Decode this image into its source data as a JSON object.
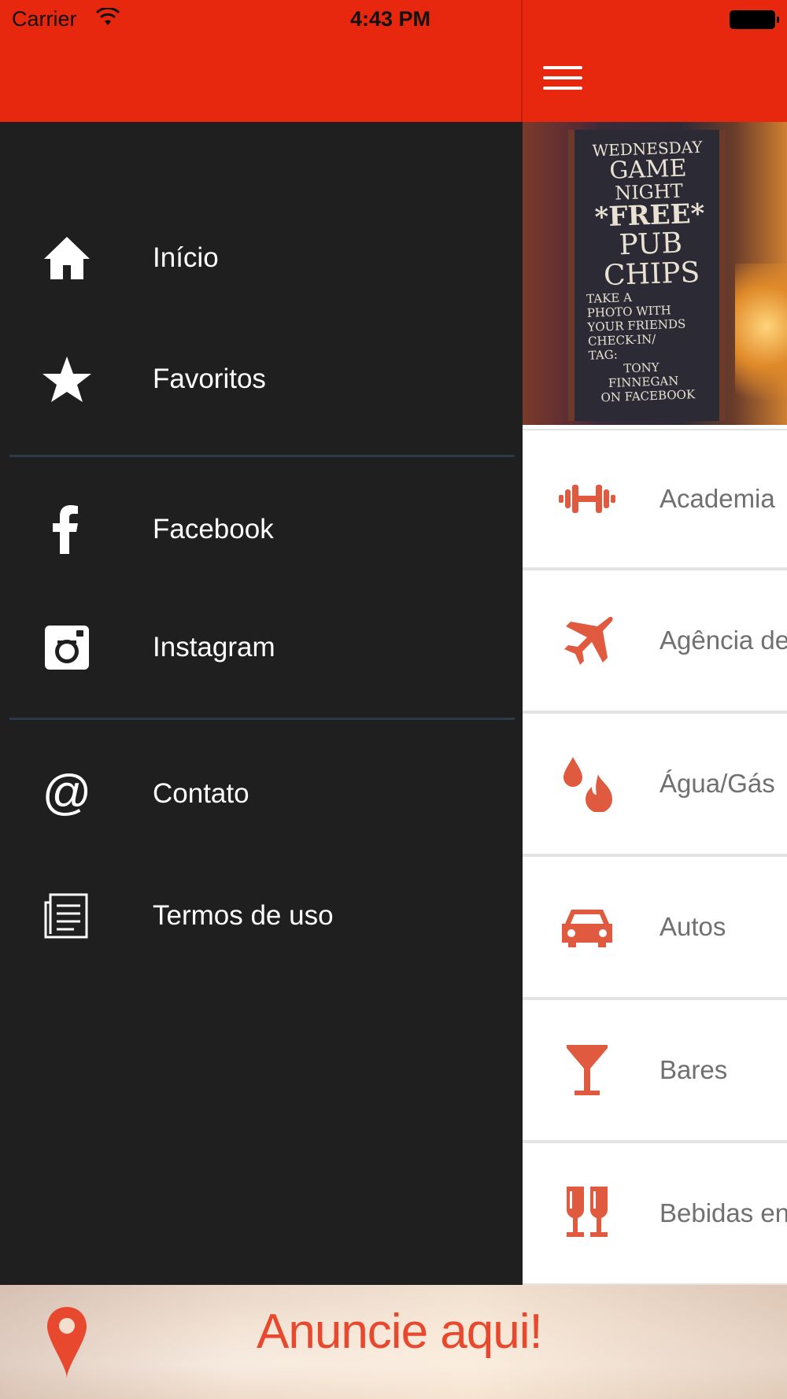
{
  "status_bar": {
    "carrier": "Carrier",
    "time": "4:43 PM"
  },
  "drawer": {
    "items": [
      {
        "label": "Início",
        "icon": "home-icon"
      },
      {
        "label": "Favoritos",
        "icon": "star-icon"
      },
      {
        "label": "Facebook",
        "icon": "facebook-icon"
      },
      {
        "label": "Instagram",
        "icon": "instagram-icon"
      },
      {
        "label": "Contato",
        "icon": "at-sign-icon"
      },
      {
        "label": "Termos de uso",
        "icon": "document-icon"
      }
    ]
  },
  "main": {
    "menu_icon": "hamburger-menu-icon",
    "banner_chalkboard": [
      "WEDNESDAY",
      "GAME",
      "NIGHT",
      "*FREE*",
      "PUB",
      "CHIPS",
      "TAKE A",
      "PHOTO WITH",
      "YOUR FRIENDS",
      "CHECK-IN/",
      "TAG:",
      "TONY",
      "FINNEGAN",
      "ON FACEBOOK"
    ],
    "categories": [
      {
        "label": "Academia",
        "icon": "dumbbell-icon"
      },
      {
        "label": "Agência de",
        "icon": "airplane-icon"
      },
      {
        "label": "Água/Gás",
        "icon": "water-fire-icon"
      },
      {
        "label": "Autos",
        "icon": "car-icon"
      },
      {
        "label": "Bares",
        "icon": "cocktail-icon"
      },
      {
        "label": "Bebidas en",
        "icon": "champagne-glasses-icon"
      }
    ]
  },
  "ad": {
    "text": "Anuncie aqui!",
    "icon": "location-pin-icon"
  },
  "colors": {
    "header_red": "#e8280e",
    "drawer_bg": "#1f1f1f",
    "accent_icon": "#e05a3f",
    "divider": "#2b3a48"
  }
}
